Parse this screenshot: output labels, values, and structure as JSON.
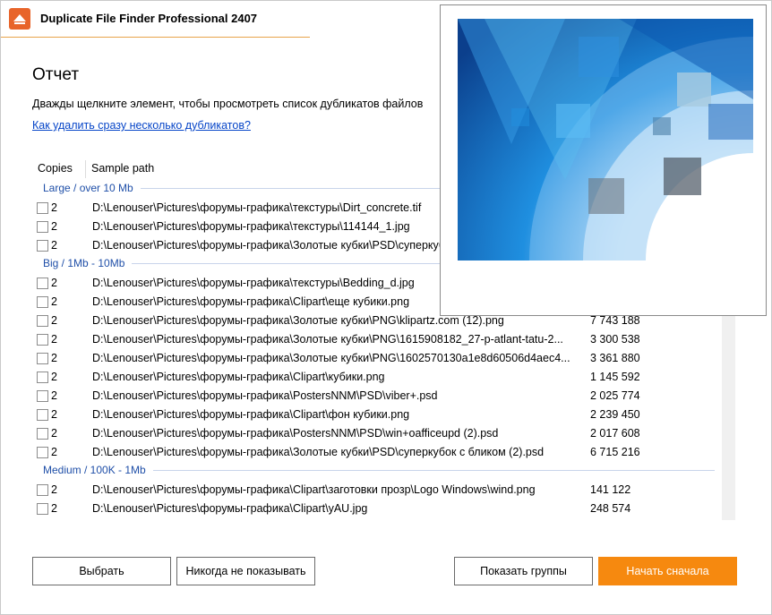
{
  "app": {
    "title": "Duplicate File Finder Professional 2407"
  },
  "report": {
    "heading": "Отчет",
    "description": "Дважды щелкните элемент, чтобы просмотреть список дубликатов файлов",
    "link": "Как удалить сразу несколько дубликатов?"
  },
  "table": {
    "columns": {
      "copies": "Copies",
      "path": "Sample path"
    },
    "groups": [
      {
        "label": "Large / over 10 Mb",
        "rows": [
          {
            "copies": "2",
            "path": "D:\\Lenouser\\Pictures\\форумы-графика\\текстуры\\Dirt_concrete.tif",
            "size": ""
          },
          {
            "copies": "2",
            "path": "D:\\Lenouser\\Pictures\\форумы-графика\\текстуры\\114144_1.jpg",
            "size": ""
          },
          {
            "copies": "2",
            "path": "D:\\Lenouser\\Pictures\\форумы-графика\\Золотые кубки\\PSD\\суперкубок",
            "size": ""
          }
        ]
      },
      {
        "label": "Big / 1Mb - 10Mb",
        "rows": [
          {
            "copies": "2",
            "path": "D:\\Lenouser\\Pictures\\форумы-графика\\текстуры\\Bedding_d.jpg",
            "size": ""
          },
          {
            "copies": "2",
            "path": "D:\\Lenouser\\Pictures\\форумы-графика\\Clipart\\еще кубики.png",
            "size": ""
          },
          {
            "copies": "2",
            "path": "D:\\Lenouser\\Pictures\\форумы-графика\\Золотые кубки\\PNG\\klipartz.com (12).png",
            "size": "7 743 188"
          },
          {
            "copies": "2",
            "path": "D:\\Lenouser\\Pictures\\форумы-графика\\Золотые кубки\\PNG\\1615908182_27-p-atlant-tatu-2...",
            "size": "3 300 538"
          },
          {
            "copies": "2",
            "path": "D:\\Lenouser\\Pictures\\форумы-графика\\Золотые кубки\\PNG\\1602570130a1e8d60506d4aec4...",
            "size": "3 361 880"
          },
          {
            "copies": "2",
            "path": "D:\\Lenouser\\Pictures\\форумы-графика\\Clipart\\кубики.png",
            "size": "1 145 592"
          },
          {
            "copies": "2",
            "path": "D:\\Lenouser\\Pictures\\форумы-графика\\PostersNNM\\PSD\\viber+.psd",
            "size": "2 025 774"
          },
          {
            "copies": "2",
            "path": "D:\\Lenouser\\Pictures\\форумы-графика\\Clipart\\фон кубики.png",
            "size": "2 239 450"
          },
          {
            "copies": "2",
            "path": "D:\\Lenouser\\Pictures\\форумы-графика\\PostersNNM\\PSD\\win+oafficeupd (2).psd",
            "size": "2 017 608"
          },
          {
            "copies": "2",
            "path": "D:\\Lenouser\\Pictures\\форумы-графика\\Золотые кубки\\PSD\\суперкубок с бликом (2).psd",
            "size": "6 715 216"
          }
        ]
      },
      {
        "label": "Medium / 100K - 1Mb",
        "rows": [
          {
            "copies": "2",
            "path": "D:\\Lenouser\\Pictures\\форумы-графика\\Clipart\\заготовки прозр\\Logo Windows\\wind.png",
            "size": "141 122"
          },
          {
            "copies": "2",
            "path": "D:\\Lenouser\\Pictures\\форумы-графика\\Clipart\\уAU.jpg",
            "size": "248 574"
          }
        ]
      }
    ]
  },
  "buttons": {
    "select": "Выбрать",
    "never_show": "Никогда не показывать",
    "show_groups": "Показать группы",
    "start_over": "Начать сначала"
  },
  "preview": {
    "icon": "image-preview"
  },
  "colors": {
    "accent": "#f6890f",
    "link": "#0645c8",
    "group_label": "#1f4fa8",
    "preview_blue": "#1a73c8"
  }
}
